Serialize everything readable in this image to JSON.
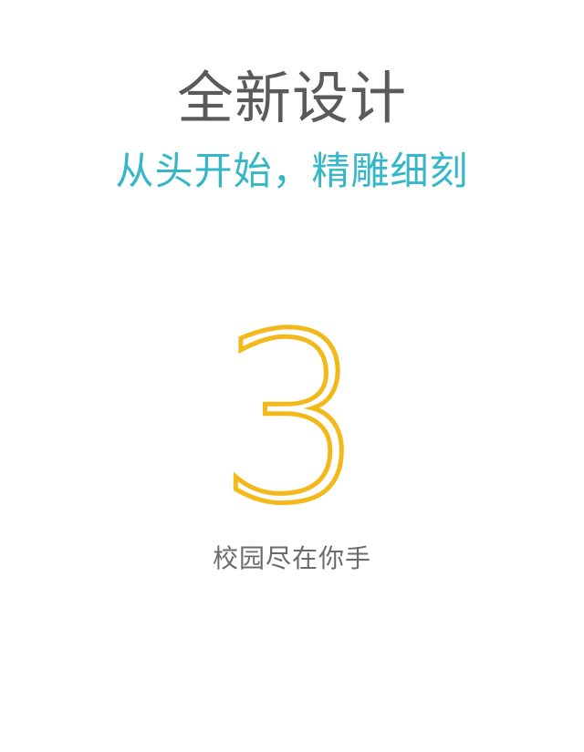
{
  "header": {
    "title": "全新设计",
    "subtitle": "从头开始，精雕细刻"
  },
  "feature": {
    "number": "3",
    "caption": "校园尽在你手"
  },
  "colors": {
    "background": "#ffffff",
    "title": "#5a5a5a",
    "subtitle": "#35b7c7",
    "number": "#f3b91a",
    "caption": "#6b6b6b"
  }
}
